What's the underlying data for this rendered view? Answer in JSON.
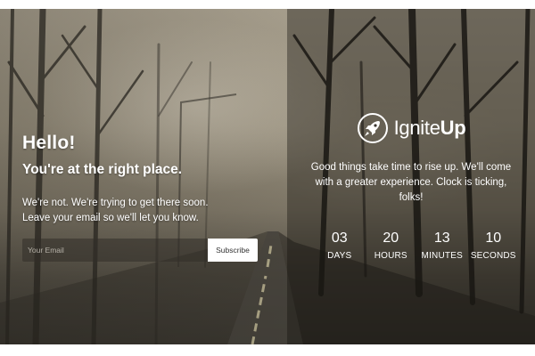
{
  "left": {
    "heading": "Hello!",
    "subheading": "You're at the right place.",
    "description_lines": [
      "We're not. We're trying to get there soon.",
      "Leave your email so we'll let you know."
    ],
    "email_placeholder": "Your Email",
    "subscribe_label": "Subscribe"
  },
  "right": {
    "brand": {
      "prefix": "Ignite",
      "suffix": "Up",
      "logo_icon": "rocket-icon"
    },
    "message": "Good things take time to rise up. We'll come with a greater experience. Clock is ticking, folks!",
    "countdown": [
      {
        "value": "03",
        "label": "DAYS"
      },
      {
        "value": "20",
        "label": "HOURS"
      },
      {
        "value": "13",
        "label": "MINUTES"
      },
      {
        "value": "10",
        "label": "SECONDS"
      }
    ]
  },
  "colors": {
    "text": "#ffffff",
    "button_bg": "#ffffff",
    "button_text": "#333333"
  }
}
